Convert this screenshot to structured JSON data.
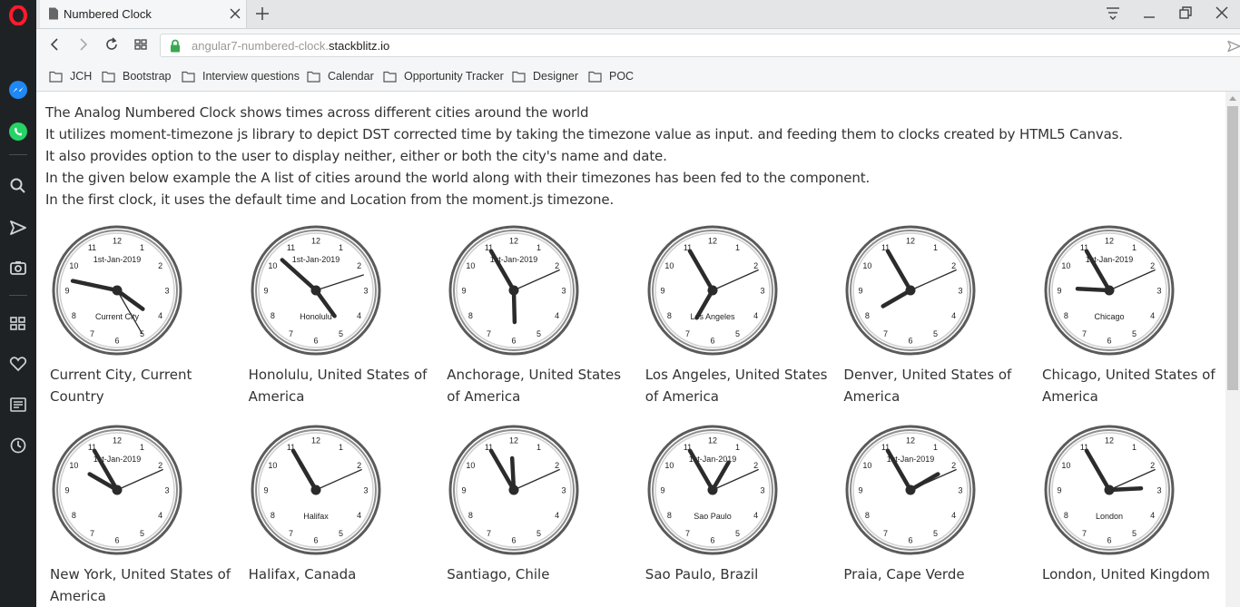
{
  "browser": {
    "tab": {
      "title": "Numbered Clock"
    },
    "address": {
      "url_prefix": "angular7-numbered-clock.",
      "url_domain": "stackblitz.io"
    },
    "bookmarks": [
      "JCH",
      "Bootstrap",
      "Interview questions",
      "Calendar",
      "Opportunity Tracker",
      "Designer",
      "POC"
    ],
    "sidebar_icons": [
      "opera-logo-icon",
      "messenger-icon",
      "whatsapp-icon",
      "search-icon",
      "send-icon",
      "camera-icon",
      "speed-dial-icon",
      "heart-icon",
      "news-icon",
      "history-icon"
    ]
  },
  "page": {
    "intro": [
      "The Analog Numbered Clock shows times across different cities around the world",
      "It utilizes moment-timezone js library to depict DST corrected time by taking the timezone value as input. and feeding them to clocks created by HTML5 Canvas.",
      "It also provides option to the user to display neither, either or both the city's name and date.",
      "In the given below example the A list of cities around the world along with their timezones has been fed to the component.",
      "In the first clock, it uses the default time and Location from the moment.js timezone."
    ],
    "clocks": [
      {
        "label": "Current City, Current Country",
        "date": "1st-Jan-2019",
        "city": "Current City",
        "hour": 4.2,
        "minute": 47,
        "second": 25
      },
      {
        "label": "Honolulu, United States of America",
        "date": "1st-Jan-2019",
        "city": "Honolulu",
        "hour": 4.8,
        "minute": 52,
        "second": 12
      },
      {
        "label": "Anchorage, United States of America",
        "date": "1st-Jan-2019",
        "city": "",
        "hour": 5.95,
        "minute": 55,
        "second": 11
      },
      {
        "label": "Los Angeles, United States of America",
        "date": "",
        "city": "Los Angeles",
        "hour": 7.0,
        "minute": 55,
        "second": 11
      },
      {
        "label": "Denver, United States of America",
        "date": "",
        "city": "",
        "hour": 8.0,
        "minute": 55,
        "second": 11
      },
      {
        "label": "Chicago, United States of America",
        "date": "1st-Jan-2019",
        "city": "Chicago",
        "hour": 9.1,
        "minute": 55,
        "second": 11
      },
      {
        "label": "New York, United States of America",
        "date": "1st-Jan-2019",
        "city": "",
        "hour": 10.0,
        "minute": 55,
        "second": 11
      },
      {
        "label": "Halifax, Canada",
        "date": "",
        "city": "Halifax",
        "hour": 11.0,
        "minute": 55,
        "second": 11
      },
      {
        "label": "Santiago, Chile",
        "date": "",
        "city": "",
        "hour": 11.9,
        "minute": 55,
        "second": 11
      },
      {
        "label": "Sao Paulo, Brazil",
        "date": "1st-Jan-2019",
        "city": "Sao Paulo",
        "hour": 1.0,
        "minute": 55,
        "second": 11
      },
      {
        "label": "Praia, Cape Verde",
        "date": "1st-Jan-2019",
        "city": "",
        "hour": 2.0,
        "minute": 55,
        "second": 11
      },
      {
        "label": "London, United Kingdom",
        "date": "",
        "city": "London",
        "hour": 2.9,
        "minute": 55,
        "second": 11
      }
    ]
  }
}
